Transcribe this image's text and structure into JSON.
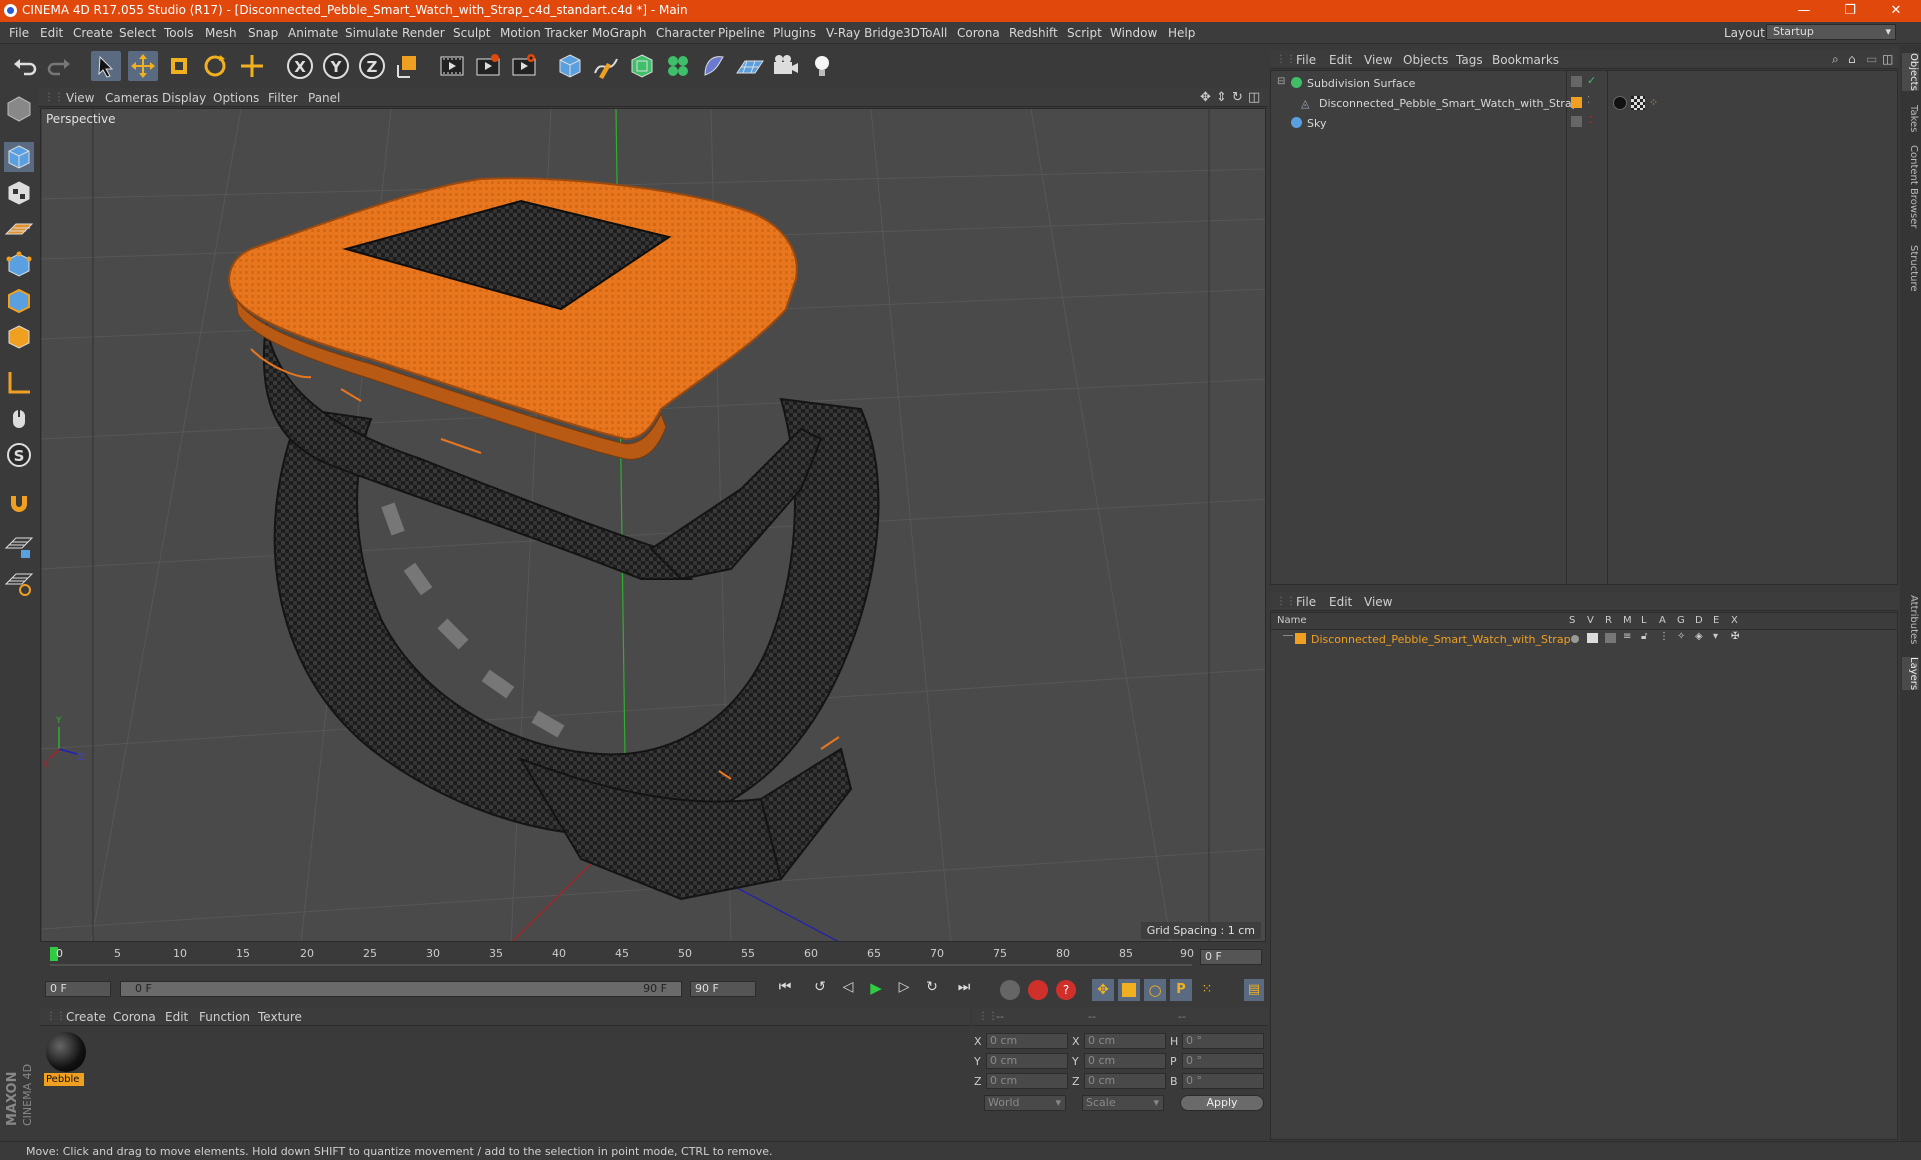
{
  "window": {
    "title": "CINEMA 4D R17.055 Studio (R17) - [Disconnected_Pebble_Smart_Watch_with_Strap_c4d_standart.c4d *] - Main",
    "minimize": "—",
    "restore": "❐",
    "close": "✕"
  },
  "menubar": {
    "items": [
      "File",
      "Edit",
      "Create",
      "Select",
      "Tools",
      "Mesh",
      "Snap",
      "Animate",
      "Simulate",
      "Render",
      "Sculpt",
      "Motion Tracker",
      "MoGraph",
      "Character",
      "Pipeline",
      "Plugins",
      "V-Ray Bridge",
      "3DToAll",
      "Corona",
      "Redshift",
      "Script",
      "Window",
      "Help"
    ],
    "layout_label": "Layout:",
    "layout_value": "Startup"
  },
  "viewport": {
    "menu": [
      "View",
      "Cameras",
      "Display",
      "Options",
      "Filter",
      "Panel"
    ],
    "label": "Perspective",
    "grid_spacing": "Grid Spacing : 1 cm"
  },
  "timeline": {
    "ticks": [
      "0",
      "5",
      "10",
      "15",
      "20",
      "25",
      "30",
      "35",
      "40",
      "45",
      "50",
      "55",
      "60",
      "65",
      "70",
      "75",
      "80",
      "85",
      "90"
    ],
    "current_frame": "0 F",
    "start_field": "0 F",
    "range_start": "0 F",
    "range_end": "90 F",
    "end_field": "90 F"
  },
  "material_panel": {
    "menu": [
      "Create",
      "Corona",
      "Edit",
      "Function",
      "Texture"
    ],
    "material_name": "Pebble"
  },
  "coordinates": {
    "headers": [
      "--",
      "--",
      "--"
    ],
    "rows": [
      {
        "l1": "X",
        "v1": "0 cm",
        "l2": "X",
        "v2": "0 cm",
        "l3": "H",
        "v3": "0 °"
      },
      {
        "l1": "Y",
        "v1": "0 cm",
        "l2": "Y",
        "v2": "0 cm",
        "l3": "P",
        "v3": "0 °"
      },
      {
        "l1": "Z",
        "v1": "0 cm",
        "l2": "Z",
        "v2": "0 cm",
        "l3": "B",
        "v3": "0 °"
      }
    ],
    "world": "World",
    "scale": "Scale",
    "apply": "Apply"
  },
  "object_manager": {
    "menu": [
      "File",
      "Edit",
      "View",
      "Objects",
      "Tags",
      "Bookmarks"
    ],
    "objects": [
      "Subdivision Surface",
      "Disconnected_Pebble_Smart_Watch_with_Strap",
      "Sky"
    ]
  },
  "layer_manager": {
    "menu": [
      "File",
      "Edit",
      "View"
    ],
    "columns": [
      "Name",
      "S",
      "V",
      "R",
      "M",
      "L",
      "A",
      "G",
      "D",
      "E",
      "X"
    ],
    "layer": "Disconnected_Pebble_Smart_Watch_with_Strap"
  },
  "right_tabs": [
    "Objects",
    "Takes",
    "Content Browser",
    "Structure",
    "Attributes",
    "Layers"
  ],
  "status": "Move: Click and drag to move elements. Hold down SHIFT to quantize movement / add to the selection in point mode, CTRL to remove.",
  "brand": "MAXON CINEMA 4D",
  "colors": {
    "title_bar": "#e0480c",
    "accent_orange": "#f0a020",
    "watch_orange": "#e8761e"
  }
}
